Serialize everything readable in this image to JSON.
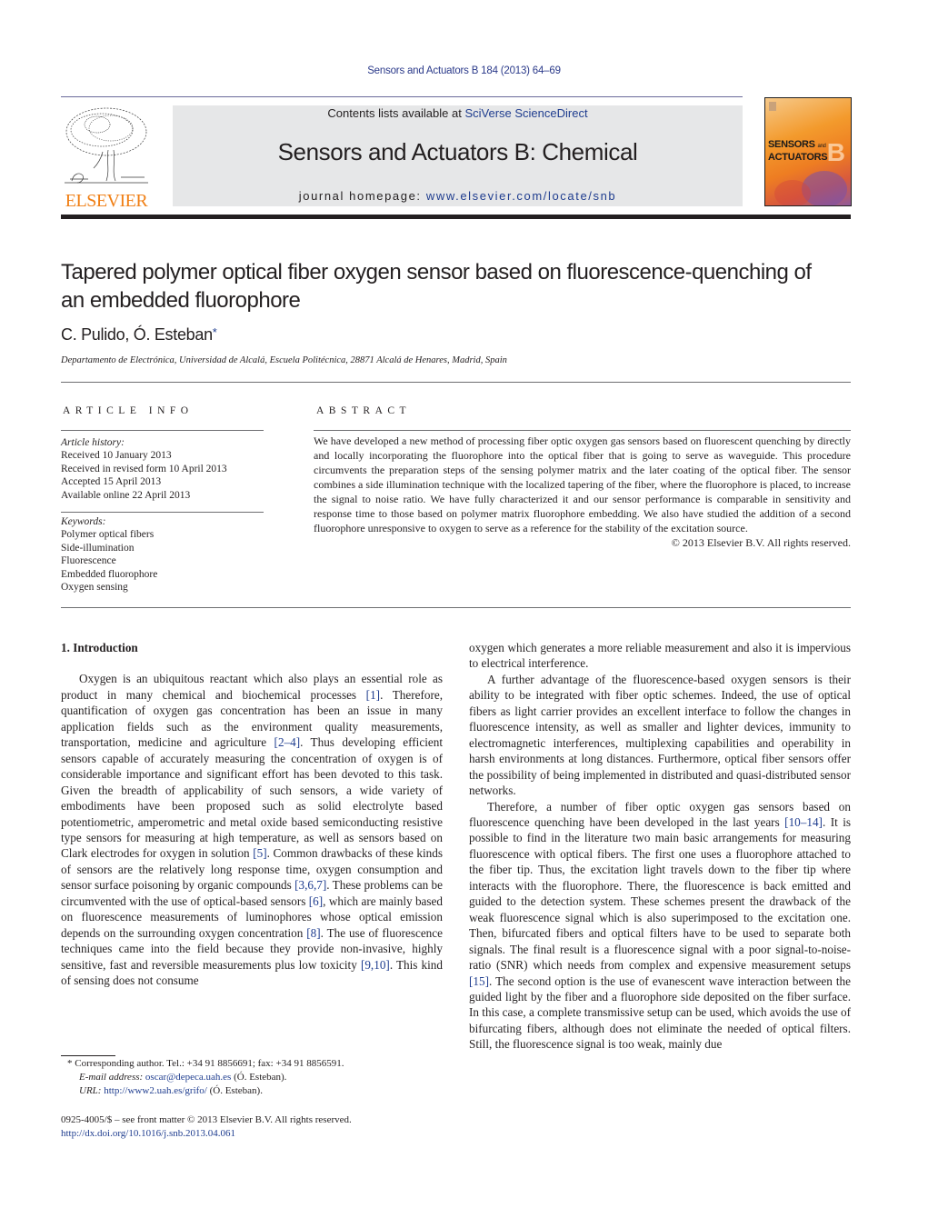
{
  "header": {
    "running_head": "Sensors and Actuators B 184 (2013) 64–69",
    "publisher_logo_text": "ELSEVIER",
    "contents_prefix": "Contents lists available at ",
    "contents_link": "SciVerse ScienceDirect",
    "journal_title": "Sensors and Actuators B: Chemical",
    "homepage_prefix": "journal homepage: ",
    "homepage_link": "www.elsevier.com/locate/snb",
    "cover_title_line1": "SENSORS",
    "cover_title_and": "and",
    "cover_title_line2": "ACTUATORS",
    "cover_letter": "B"
  },
  "article": {
    "title_line1": "Tapered polymer optical fiber oxygen sensor based on fluorescence-quenching of",
    "title_line2": "an embedded fluorophore",
    "authors": "C. Pulido, Ó. Esteban",
    "author_mark": "*",
    "affiliation": "Departamento de Electrónica, Universidad de Alcalá, Escuela Politécnica, 28871 Alcalá de Henares, Madrid, Spain"
  },
  "article_info": {
    "heading": "ARTICLE INFO",
    "history_label": "Article history:",
    "history": [
      "Received 10 January 2013",
      "Received in revised form 10 April 2013",
      "Accepted 15 April 2013",
      "Available online 22 April 2013"
    ],
    "keywords_label": "Keywords:",
    "keywords": [
      "Polymer optical fibers",
      "Side-illumination",
      "Fluorescence",
      "Embedded fluorophore",
      "Oxygen sensing"
    ]
  },
  "abstract": {
    "heading": "ABSTRACT",
    "text": "We have developed a new method of processing fiber optic oxygen gas sensors based on fluorescent quenching by directly and locally incorporating the fluorophore into the optical fiber that is going to serve as waveguide. This procedure circumvents the preparation steps of the sensing polymer matrix and the later coating of the optical fiber. The sensor combines a side illumination technique with the localized tapering of the fiber, where the fluorophore is placed, to increase the signal to noise ratio. We have fully characterized it and our sensor performance is comparable in sensitivity and response time to those based on polymer matrix fluorophore embedding. We also have studied the addition of a second fluorophore unresponsive to oxygen to serve as a reference for the stability of the excitation source.",
    "copyright": "© 2013 Elsevier B.V. All rights reserved."
  },
  "body": {
    "section1_heading": "1.  Introduction",
    "left": {
      "p1_a": "Oxygen is an ubiquitous reactant which also plays an essential role as product in many chemical and biochemical processes ",
      "ref1": "[1]",
      "p1_b": ". Therefore, quantification of oxygen gas concentration has been an issue in many application fields such as the environment quality measurements, transportation, medicine and agriculture ",
      "ref2": "[2–4]",
      "p1_c": ". Thus developing efficient sensors capable of accurately measuring the concentration of oxygen is of considerable importance and significant effort has been devoted to this task. Given the breadth of applicability of such sensors, a wide variety of embodiments have been proposed such as solid electrolyte based potentiometric, amperometric and metal oxide based semiconducting resistive type sensors for measuring at high temperature, as well as sensors based on Clark electrodes for oxygen in solution ",
      "ref3": "[5]",
      "p1_d": ". Common drawbacks of these kinds of sensors are the relatively long response time, oxygen consumption and sensor surface poisoning by organic compounds ",
      "ref4": "[3,6,7]",
      "p1_e": ". These problems can be circumvented with the use of optical-based sensors ",
      "ref5": "[6]",
      "p1_f": ", which are mainly based on fluorescence measurements of luminophores whose optical emission depends on the surrounding oxygen concentration ",
      "ref6": "[8]",
      "p1_g": ". The use of fluorescence techniques came into the field because they provide non-invasive, highly sensitive, fast and reversible measurements plus low toxicity ",
      "ref7": "[9,10]",
      "p1_h": ". This kind of sensing does not consume"
    },
    "right": {
      "p0": "oxygen which generates a more reliable measurement and also it is impervious to electrical interference.",
      "p2": "A further advantage of the fluorescence-based oxygen sensors is their ability to be integrated with fiber optic schemes. Indeed, the use of optical fibers as light carrier provides an excellent interface to follow the changes in fluorescence intensity, as well as smaller and lighter devices, immunity to electromagnetic interferences, multiplexing capabilities and operability in harsh environments at long distances. Furthermore, optical fiber sensors offer the possibility of being implemented in distributed and quasi-distributed sensor networks.",
      "p3_a": "Therefore, a number of fiber optic oxygen gas sensors based on fluorescence quenching have been developed in the last years ",
      "ref8": "[10–14]",
      "p3_b": ". It is possible to find in the literature two main basic arrangements for measuring fluorescence with optical fibers. The first one uses a fluorophore attached to the fiber tip. Thus, the excitation light travels down to the fiber tip where interacts with the fluorophore. There, the fluorescence is back emitted and guided to the detection system. These schemes present the drawback of the weak fluorescence signal which is also superimposed to the excitation one. Then, bifurcated fibers and optical filters have to be used to separate both signals. The final result is a fluorescence signal with a poor signal-to-noise-ratio (SNR) which needs from complex and expensive measurement setups ",
      "ref9": "[15]",
      "p3_c": ". The second option is the use of evanescent wave interaction between the guided light by the fiber and a fluorophore side deposited on the fiber surface. In this case, a complete transmissive setup can be used, which avoids the use of bifurcating fibers, although does not eliminate the needed of optical filters. Still, the fluorescence signal is too weak, mainly due"
    }
  },
  "footnotes": {
    "corr": "* Corresponding author. Tel.: +34 91 8856691; fax: +34 91 8856591.",
    "email_label": "E-mail address: ",
    "email": "oscar@depeca.uah.es",
    "email_suffix": " (Ó. Esteban).",
    "url_label": "URL: ",
    "url": "http://www2.uah.es/grifo/",
    "url_suffix": " (Ó. Esteban).",
    "frontmatter": "0925-4005/$ – see front matter © 2013 Elsevier B.V. All rights reserved.",
    "doi": "http://dx.doi.org/10.1016/j.snb.2013.04.061"
  }
}
